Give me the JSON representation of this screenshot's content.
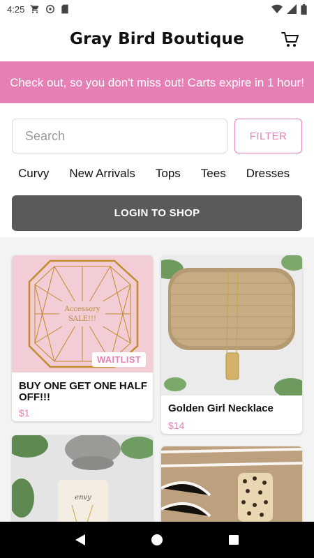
{
  "status_bar": {
    "time": "4:25",
    "icons": [
      "cart-notification-icon",
      "sync-icon",
      "sd-card-icon"
    ],
    "right_icons": [
      "wifi-icon",
      "signal-icon",
      "battery-icon"
    ]
  },
  "header": {
    "title": "Gray Bird Boutique",
    "cart_icon": "cart-icon"
  },
  "banner": {
    "text": "Check out, so you don't miss out! Carts expire in 1 hour!",
    "bg_color": "#e580b5"
  },
  "search": {
    "placeholder": "Search",
    "value": "",
    "filter_label": "FILTER"
  },
  "categories": [
    "Curvy",
    "New Arrivals",
    "Tops",
    "Tees",
    "Dresses"
  ],
  "login": {
    "label": "LOGIN TO SHOP"
  },
  "products": [
    {
      "name": "BUY ONE GET ONE HALF OFF!!!",
      "price": "$1",
      "badge": "WAITLIST",
      "image_text": "Accessory SALE!!!"
    },
    {
      "name": "Golden Girl Necklace",
      "price": "$14"
    },
    {
      "name": "",
      "price": "",
      "image_text": "envy"
    },
    {
      "name": "",
      "price": ""
    }
  ],
  "accent_color": "#e580b5",
  "nav": [
    "back-icon",
    "home-icon",
    "recents-icon"
  ]
}
